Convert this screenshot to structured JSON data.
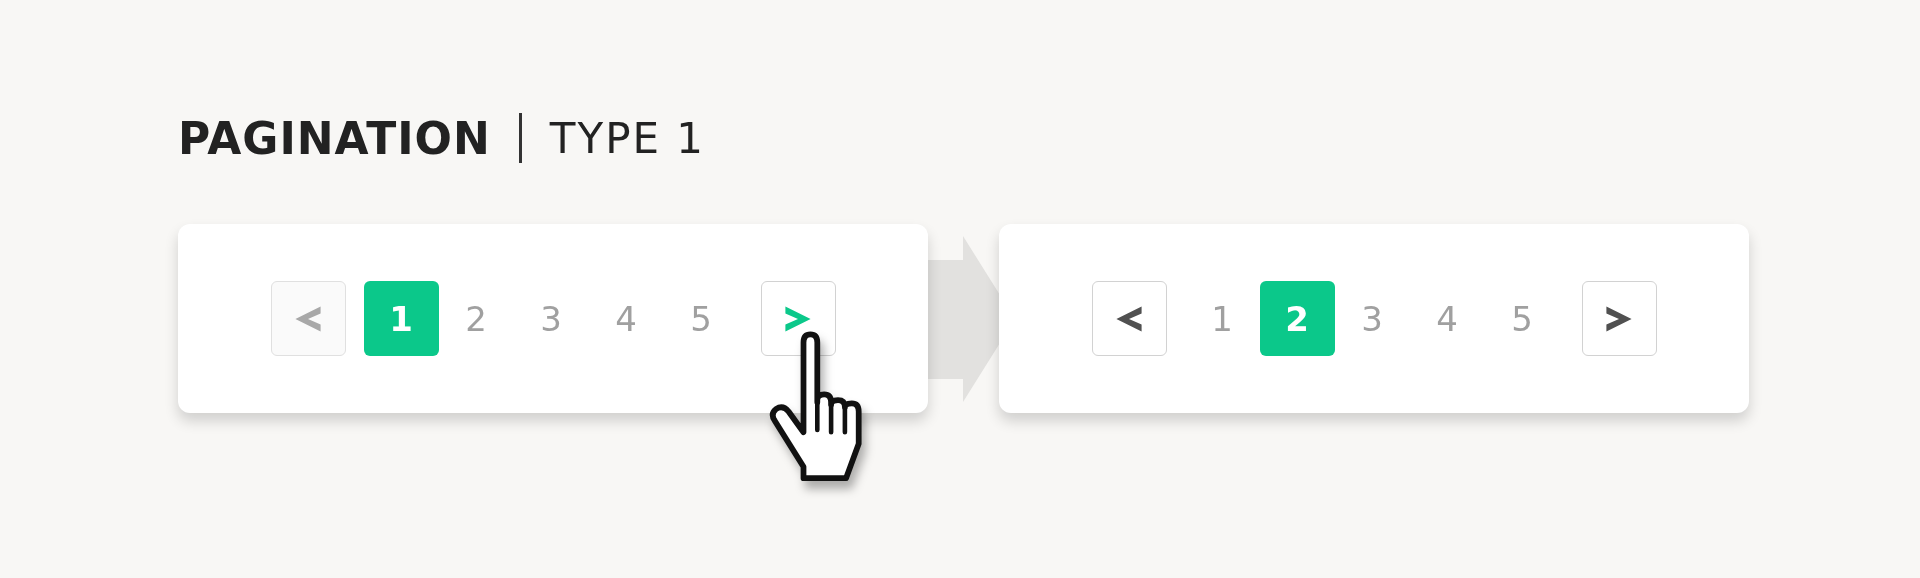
{
  "title": {
    "main": "PAGINATION",
    "sub": "TYPE 1"
  },
  "panels": [
    {
      "prev": {
        "disabled": true
      },
      "pages": [
        {
          "label": "1",
          "selected": true
        },
        {
          "label": "2",
          "selected": false
        },
        {
          "label": "3",
          "selected": false
        },
        {
          "label": "4",
          "selected": false
        },
        {
          "label": "5",
          "selected": false
        }
      ],
      "next": {
        "disabled": false,
        "hovered": true
      },
      "cursor": true
    },
    {
      "prev": {
        "disabled": false
      },
      "pages": [
        {
          "label": "1",
          "selected": false
        },
        {
          "label": "2",
          "selected": true
        },
        {
          "label": "3",
          "selected": false
        },
        {
          "label": "4",
          "selected": false
        },
        {
          "label": "5",
          "selected": false
        }
      ],
      "next": {
        "disabled": false,
        "hovered": false
      },
      "cursor": false
    }
  ]
}
